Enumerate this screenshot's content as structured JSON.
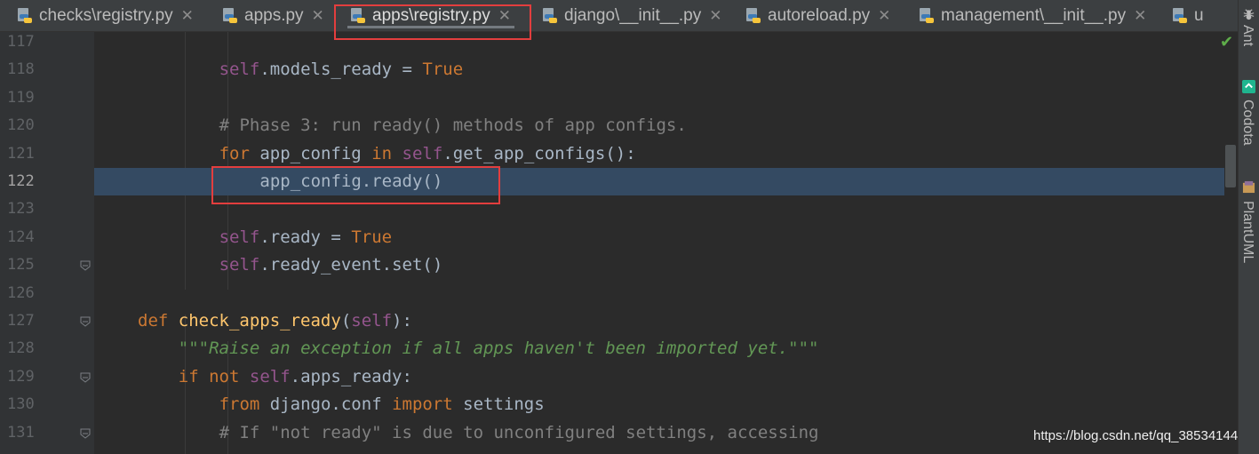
{
  "tabs": [
    {
      "label": "checks\\registry.py",
      "active": false
    },
    {
      "label": "apps.py",
      "active": false
    },
    {
      "label": "apps\\registry.py",
      "active": true
    },
    {
      "label": "django\\__init__.py",
      "active": false
    },
    {
      "label": "autoreload.py",
      "active": false
    },
    {
      "label": "management\\__init__.py",
      "active": false
    },
    {
      "label": "u",
      "active": false
    }
  ],
  "right_strip": {
    "ant": "Ant",
    "codota": "Codota",
    "plantuml": "PlantUML"
  },
  "editor": {
    "current_line": "122",
    "lines": [
      {
        "num": "117",
        "segments": []
      },
      {
        "num": "118",
        "segments": [
          {
            "t": "self",
            "c": "self"
          },
          {
            "t": ".models_ready = ",
            "c": ""
          },
          {
            "t": "True",
            "c": "kw"
          }
        ]
      },
      {
        "num": "119",
        "segments": []
      },
      {
        "num": "120",
        "segments": [
          {
            "t": "# Phase 3: run ready() methods of app configs.",
            "c": "cm"
          }
        ]
      },
      {
        "num": "121",
        "segments": [
          {
            "t": "for",
            "c": "kw"
          },
          {
            "t": " app_config ",
            "c": ""
          },
          {
            "t": "in",
            "c": "kw"
          },
          {
            "t": " ",
            "c": ""
          },
          {
            "t": "self",
            "c": "self"
          },
          {
            "t": ".get_app_configs():",
            "c": ""
          }
        ]
      },
      {
        "num": "122",
        "segments": [
          {
            "t": "app_config.ready()",
            "c": ""
          }
        ]
      },
      {
        "num": "123",
        "segments": []
      },
      {
        "num": "124",
        "segments": [
          {
            "t": "self",
            "c": "self"
          },
          {
            "t": ".ready = ",
            "c": ""
          },
          {
            "t": "True",
            "c": "kw"
          }
        ]
      },
      {
        "num": "125",
        "segments": [
          {
            "t": "self",
            "c": "self"
          },
          {
            "t": ".ready_event.set()",
            "c": ""
          }
        ]
      },
      {
        "num": "126",
        "segments": []
      },
      {
        "num": "127",
        "segments": [
          {
            "t": "def",
            "c": "kw"
          },
          {
            "t": " ",
            "c": ""
          },
          {
            "t": "check_apps_ready",
            "c": "fn"
          },
          {
            "t": "(",
            "c": ""
          },
          {
            "t": "self",
            "c": "self"
          },
          {
            "t": "):",
            "c": ""
          }
        ]
      },
      {
        "num": "128",
        "segments": [
          {
            "t": "\"\"\"Raise an exception if all apps haven't been imported yet.\"\"\"",
            "c": "doc"
          }
        ]
      },
      {
        "num": "129",
        "segments": [
          {
            "t": "if not",
            "c": "kw"
          },
          {
            "t": " ",
            "c": ""
          },
          {
            "t": "self",
            "c": "self"
          },
          {
            "t": ".apps_ready:",
            "c": ""
          }
        ]
      },
      {
        "num": "130",
        "segments": [
          {
            "t": "from",
            "c": "kw"
          },
          {
            "t": " django.conf ",
            "c": ""
          },
          {
            "t": "import",
            "c": "kw"
          },
          {
            "t": " settings",
            "c": ""
          }
        ]
      },
      {
        "num": "131",
        "segments": [
          {
            "t": "# If \"not ready\" is due to unconfigured settings, accessing",
            "c": "cm"
          }
        ]
      }
    ]
  },
  "watermark": "https://blog.csdn.net/qq_38534144"
}
